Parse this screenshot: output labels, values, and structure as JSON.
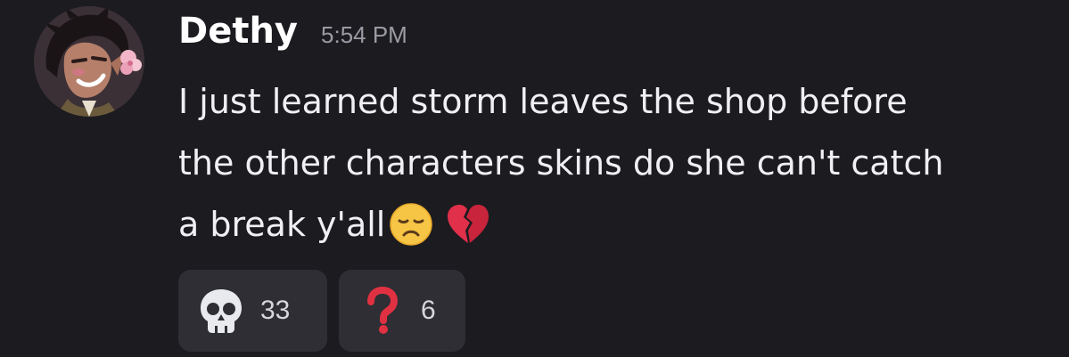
{
  "message": {
    "author": "Dethy",
    "timestamp": "5:54 PM",
    "lines": [
      "I just learned storm leaves the shop before",
      "the other characters skins do she can't catch",
      "a break y'all"
    ],
    "inline_emojis": [
      "disappointed-face",
      "broken-heart"
    ]
  },
  "reactions": [
    {
      "emoji": "skull",
      "count": "33"
    },
    {
      "emoji": "red-question-mark",
      "count": "6"
    }
  ],
  "colors": {
    "background": "#1c1b20",
    "reaction_bg": "#2e2e34",
    "username": "#ffffff",
    "timestamp": "#9a9ba3",
    "text": "#f0f0f3"
  }
}
